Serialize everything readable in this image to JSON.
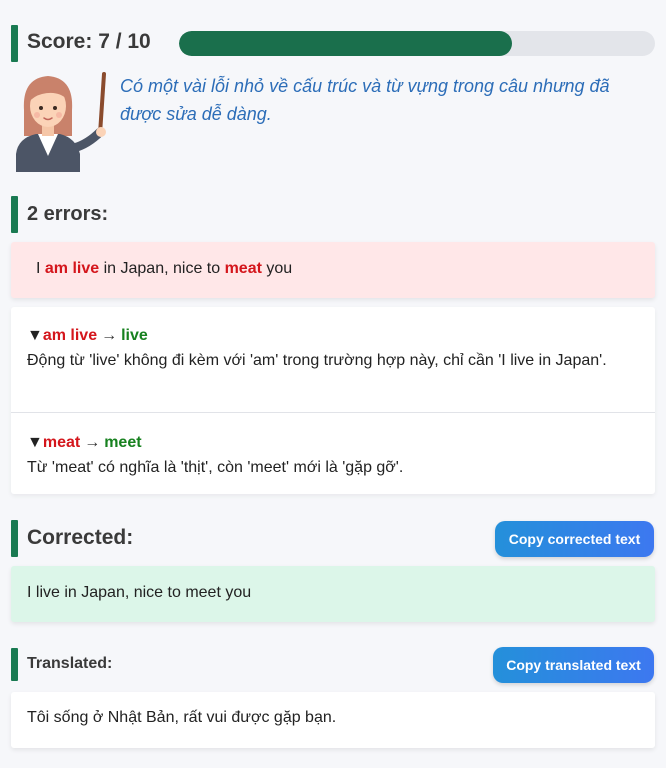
{
  "score": {
    "label": "Score: 7 / 10",
    "value": 7,
    "max": 10
  },
  "feedback": {
    "avatar_icon": "teacher-avatar-icon",
    "text": "Có một vài lỗi nhỏ về cấu trúc và từ vựng trong câu nhưng đã được sửa dễ dàng."
  },
  "errors_section": {
    "heading": "2 errors:"
  },
  "original_sentence": {
    "segments": [
      {
        "text": "I ",
        "type": "normal"
      },
      {
        "text": "am live",
        "type": "error"
      },
      {
        "text": " in Japan, nice to ",
        "type": "normal"
      },
      {
        "text": "meat",
        "type": "error"
      },
      {
        "text": " you",
        "type": "normal"
      }
    ]
  },
  "errors": [
    {
      "toggle": "▼",
      "wrong": "am live",
      "arrow": "→",
      "correct": "live",
      "explanation": "Động từ 'live' không đi kèm với 'am' trong trường hợp này, chỉ cần 'I live in Japan'."
    },
    {
      "toggle": "▼",
      "wrong": "meat",
      "arrow": "→",
      "correct": "meet",
      "explanation": "Từ 'meat' có nghĩa là 'thịt', còn 'meet' mới là 'gặp gỡ'."
    }
  ],
  "corrected": {
    "heading": "Corrected:",
    "copy_button": "Copy corrected text",
    "text": "I live in Japan, nice to meet you"
  },
  "translated": {
    "heading": "Translated:",
    "copy_button": "Copy translated text",
    "text": "Tôi sống ở Nhật Bản, rất vui được gặp bạn."
  },
  "colors": {
    "accent": "#1a7a52",
    "error": "#d4161c",
    "fix": "#17811f",
    "feedback": "#2c6db8",
    "button": "#2e86e4"
  }
}
